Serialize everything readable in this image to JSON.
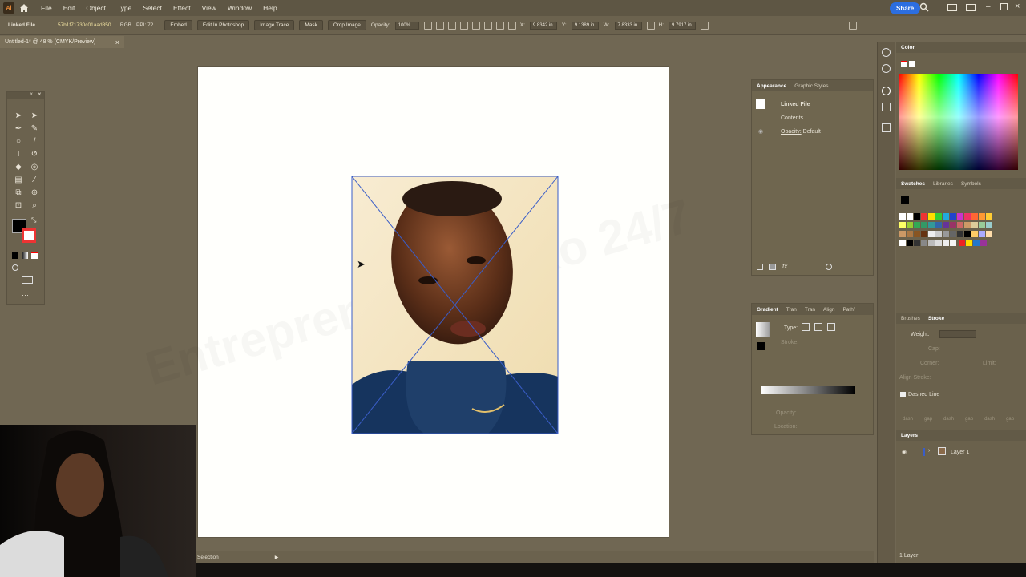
{
  "app": {
    "logo_text": "Ai",
    "share_label": "Share"
  },
  "menu": [
    "File",
    "Edit",
    "Object",
    "Type",
    "Select",
    "Effect",
    "View",
    "Window",
    "Help"
  ],
  "controlbar": {
    "selection_type": "Linked File",
    "file_id": "57b1f71730c01aad850...",
    "color_mode": "RGB",
    "ppi": "PPI: 72",
    "embed": "Embed",
    "edit_in_photoshop": "Edit In Photoshop",
    "image_trace": "Image Trace",
    "mask": "Mask",
    "crop_image": "Crop Image",
    "opacity_label": "Opacity:",
    "opacity_value": "100%",
    "x_label": "X:",
    "x_value": "9.8342 in",
    "y_label": "Y:",
    "y_value": "9.1389 in",
    "w_label": "W:",
    "w_value": "7.8333 in",
    "h_label": "H:",
    "h_value": "9.7917 in"
  },
  "document": {
    "tab_title": "Untitled-1* @ 48 % (CMYK/Preview)",
    "close_glyph": "×"
  },
  "canvas": {
    "watermark": "Entrepreneur Ho Ko 24/7"
  },
  "appearance_panel": {
    "tabs": [
      "Appearance",
      "Graphic Styles"
    ],
    "object": "Linked File",
    "contents": "Contents",
    "opacity_label": "Opacity:",
    "opacity_value": "Default"
  },
  "gradient_panel": {
    "tabs": [
      "Gradient",
      "Tran",
      "Tran",
      "Align",
      "Pathf"
    ],
    "type_label": "Type:",
    "stroke_label": "Stroke:",
    "opacity_label": "Opacity:",
    "location_label": "Location:"
  },
  "color_panel": {
    "title": "Color"
  },
  "swatches_panel": {
    "tabs": [
      "Swatches",
      "Libraries",
      "Symbols"
    ]
  },
  "stroke_panel": {
    "tabs": [
      "Brushes",
      "Stroke"
    ],
    "weight_label": "Weight:",
    "cap_label": "Cap:",
    "corner_label": "Corner:",
    "limit_label": "Limit:",
    "align_label": "Align Stroke:",
    "dashed_line": "Dashed Line",
    "dash_labels": [
      "dash",
      "gap",
      "dash",
      "gap",
      "dash",
      "gap"
    ]
  },
  "layers_panel": {
    "title": "Layers",
    "layer_name": "Layer 1",
    "footer": "1 Layer"
  },
  "statusbar": {
    "tool_name": "Selection"
  },
  "colors": {
    "ui_bg": "#706753",
    "share": "#2c6ee0",
    "accent_blue": "#3a5dc8"
  }
}
